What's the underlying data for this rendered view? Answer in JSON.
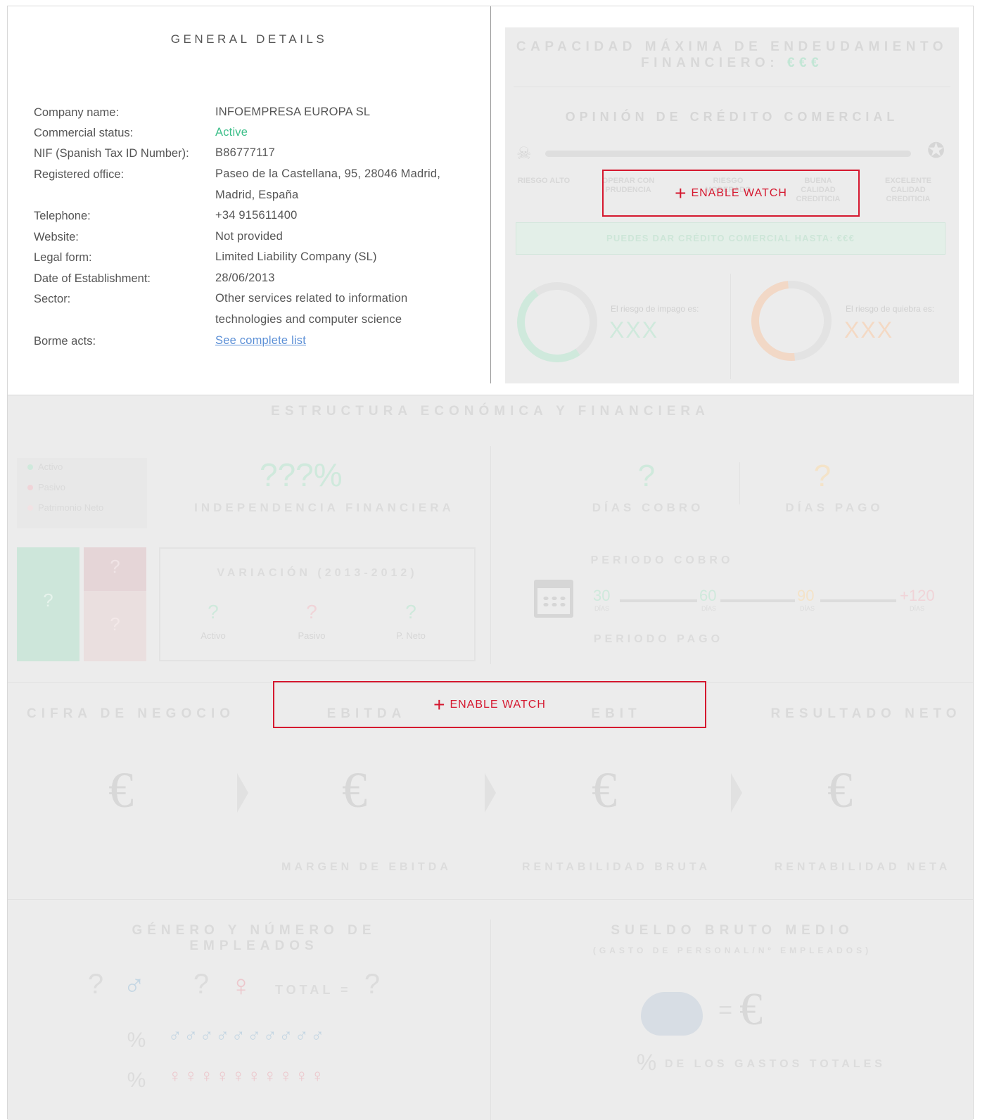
{
  "general": {
    "title": "GENERAL DETAILS",
    "rows": [
      {
        "label": "Company name:",
        "value": "INFOEMPRESA EUROPA SL"
      },
      {
        "label": "Commercial status:",
        "value": "Active"
      },
      {
        "label": "NIF (Spanish Tax ID Number):",
        "value": "B86777117"
      },
      {
        "label": "Registered office:",
        "value": "Paseo de la Castellana, 95, 28046 Madrid, Madrid, España"
      },
      {
        "label": "Telephone:",
        "value": "+34 915611400"
      },
      {
        "label": "Website:",
        "value": "Not provided"
      },
      {
        "label": "Legal form:",
        "value": "Limited Liability Company (SL)"
      },
      {
        "label": "Date of Establishment:",
        "value": "28/06/2013"
      },
      {
        "label": "Sector:",
        "value": "Other services related to information technologies and computer science"
      },
      {
        "label": "Borme acts:",
        "value": "See complete list"
      }
    ]
  },
  "credit": {
    "title_line1": "CAPACIDAD MÁXIMA DE ENDEUDAMIENTO",
    "title_line2": "FINANCIERO:",
    "title_value": "€€€",
    "opinion_title": "OPINIÓN DE CRÉDITO COMERCIAL",
    "levels": [
      "RIESGO ALTO",
      "OPERAR CON PRUDENCIA",
      "RIESGO MODERADO",
      "BUENA CALIDAD CREDITICIA",
      "EXCELENTE CALIDAD CREDITICIA"
    ],
    "green_bar": "PUEDES DAR CRÉDITO COMERCIAL HASTA: €€€",
    "impago_label": "El riesgo de impago es:",
    "impago_value": "XXX",
    "quiebra_label": "El riesgo de quiebra es:",
    "quiebra_value": "XXX",
    "enable": "ENABLE WATCH"
  },
  "structure": {
    "title": "ESTRUCTURA  ECONÓMICA Y FINANCIERA",
    "legend": [
      "Activo",
      "Pasivo",
      "Patrimonio Neto"
    ],
    "independence_value": "???%",
    "independence_label": "INDEPENDENCIA FINANCIERA",
    "variation_title": "VARIACIÓN (2013-2012)",
    "variation_items": [
      "Activo",
      "Pasivo",
      "P. Neto"
    ],
    "q": "?",
    "dias_cobro": "DÍAS COBRO",
    "dias_pago": "DÍAS PAGO",
    "periodo_cobro": "PERIODO COBRO",
    "periodo_pago": "PERIODO PAGO",
    "timeline": [
      "30",
      "60",
      "90",
      "+120"
    ],
    "dias": "DÍAS"
  },
  "results": {
    "headers": [
      "CIFRA DE NEGOCIO",
      "EBITDA",
      "EBIT",
      "RESULTADO NETO"
    ],
    "euro": "€",
    "margins": [
      "MARGEN DE EBITDA",
      "RENTABILIDAD BRUTA",
      "RENTABILIDAD NETA"
    ],
    "enable": "ENABLE WATCH"
  },
  "employees": {
    "title": "GÉNERO Y NÚMERO DE EMPLEADOS",
    "total_label": "TOTAL =",
    "q": "?",
    "percent": "%",
    "salary_title": "SUELDO BRUTO MEDIO",
    "salary_sub": "(GASTO DE PERSONAL/Nº EMPLEADOS)",
    "equals": "=",
    "euro": "€",
    "gastos_label": "DE LOS GASTOS TOTALES"
  },
  "colors": {
    "accent_red": "#d5182f",
    "active_green": "#3dbf8a",
    "link_blue": "#5b8fd6"
  }
}
